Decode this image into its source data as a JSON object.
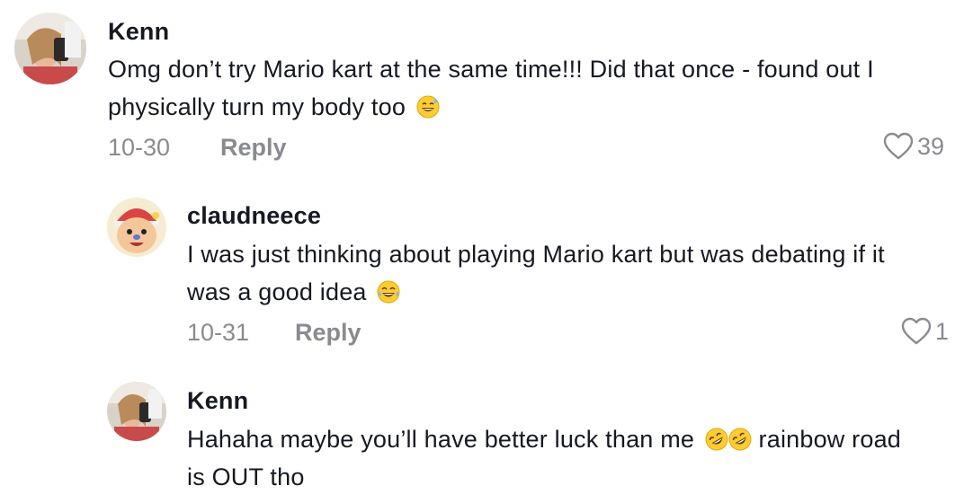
{
  "comments": [
    {
      "username": "Kenn",
      "text": "Omg don’t try Mario kart at the same time!!! Did that once - found out I",
      "text_line2": "physically turn my body too",
      "emoji": "sweat-smile-emoji",
      "date": "10-30",
      "reply_label": "Reply",
      "likes": "39",
      "avatar": "user-photo-avatar"
    },
    {
      "username": "claudneece",
      "text": "I was just thinking about playing Mario kart but was debating if it",
      "text_line2": "was a good idea",
      "emoji": "joy-emoji",
      "date": "10-31",
      "reply_label": "Reply",
      "likes": "1",
      "avatar": "cartoon-character-avatar"
    },
    {
      "username": "Kenn",
      "text": "Hahaha maybe you’ll have better luck than me",
      "text_after_emoji": "rainbow road",
      "text_line2": "is OUT tho",
      "emoji": "rofl-emoji",
      "avatar": "user-photo-avatar"
    }
  ],
  "colors": {
    "text": "#161823",
    "meta": "#8a8b91",
    "background": "#ffffff"
  }
}
